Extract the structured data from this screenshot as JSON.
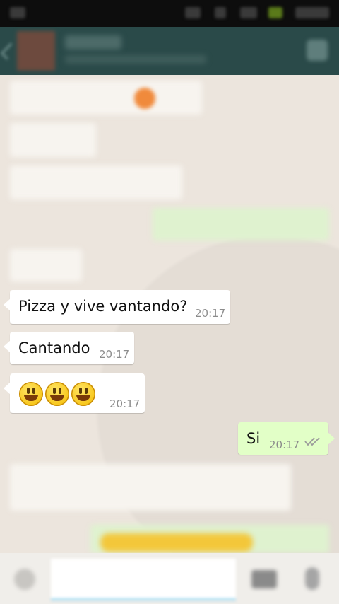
{
  "messages": [
    {
      "text": "Pizza y vive vantando?",
      "time": "20:17",
      "direction": "in"
    },
    {
      "text": "Cantando",
      "time": "20:17",
      "direction": "in"
    },
    {
      "text": "",
      "emoji": [
        "smiley-icon",
        "smiley-icon",
        "smiley-icon"
      ],
      "time": "20:17",
      "direction": "in"
    },
    {
      "text": "Si",
      "time": "20:17",
      "direction": "out",
      "status": "double-tick-icon"
    }
  ],
  "colors": {
    "action_bar": "#2a4a49",
    "chat_background": "#ece5dd",
    "incoming_bubble": "#ffffff",
    "outgoing_bubble": "#e2ffc7",
    "timestamp": "#8c8c8c"
  }
}
